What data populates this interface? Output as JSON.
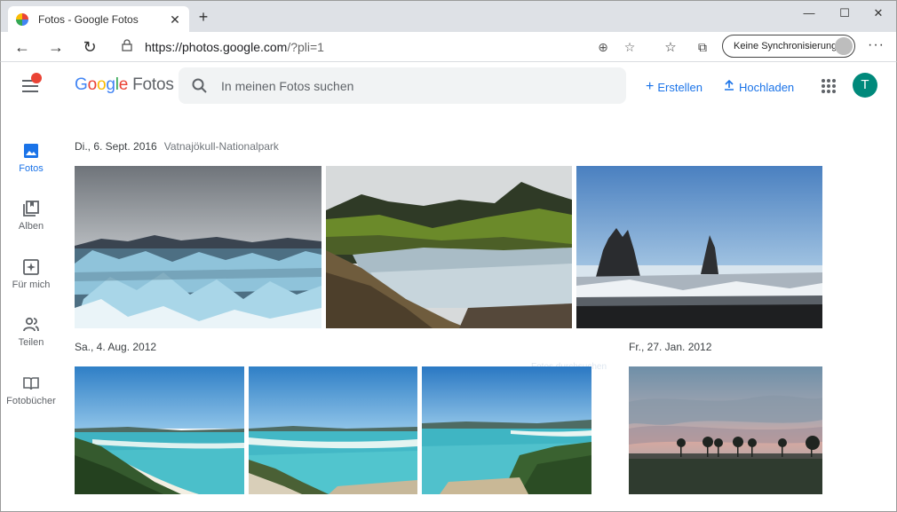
{
  "browser": {
    "tab_title": "Fotos - Google Fotos",
    "url_host": "https://photos.google.com",
    "url_path": "/?pli=1",
    "sync_label": "Keine Synchronisierung"
  },
  "header": {
    "logo_letters": [
      "G",
      "o",
      "o",
      "g",
      "l",
      "e"
    ],
    "logo_product": "Fotos",
    "search_placeholder": "In meinen Fotos suchen",
    "create_label": "Erstellen",
    "upload_label": "Hochladen",
    "avatar_letter": "T",
    "avatar_color": "#00897b"
  },
  "sidebar": {
    "items": [
      {
        "label": "Fotos",
        "icon": "photo-icon",
        "active": true
      },
      {
        "label": "Alben",
        "icon": "album-icon",
        "active": false
      },
      {
        "label": "Für mich",
        "icon": "for-you-icon",
        "active": false
      },
      {
        "label": "Teilen",
        "icon": "sharing-icon",
        "active": false
      },
      {
        "label": "Fotobücher",
        "icon": "photobook-icon",
        "active": false
      }
    ]
  },
  "groups": [
    {
      "date": "Di., 6. Sept. 2016",
      "location": "Vatnajökull-Nationalpark"
    },
    {
      "date": "Sa., 4. Aug. 2012",
      "location": ""
    },
    {
      "date": "Fr., 27. Jan. 2012",
      "location": ""
    }
  ],
  "faded_hint": "Fotos durchsuchen",
  "colors": {
    "accent": "#1a73e8",
    "notification": "#ea4335"
  }
}
